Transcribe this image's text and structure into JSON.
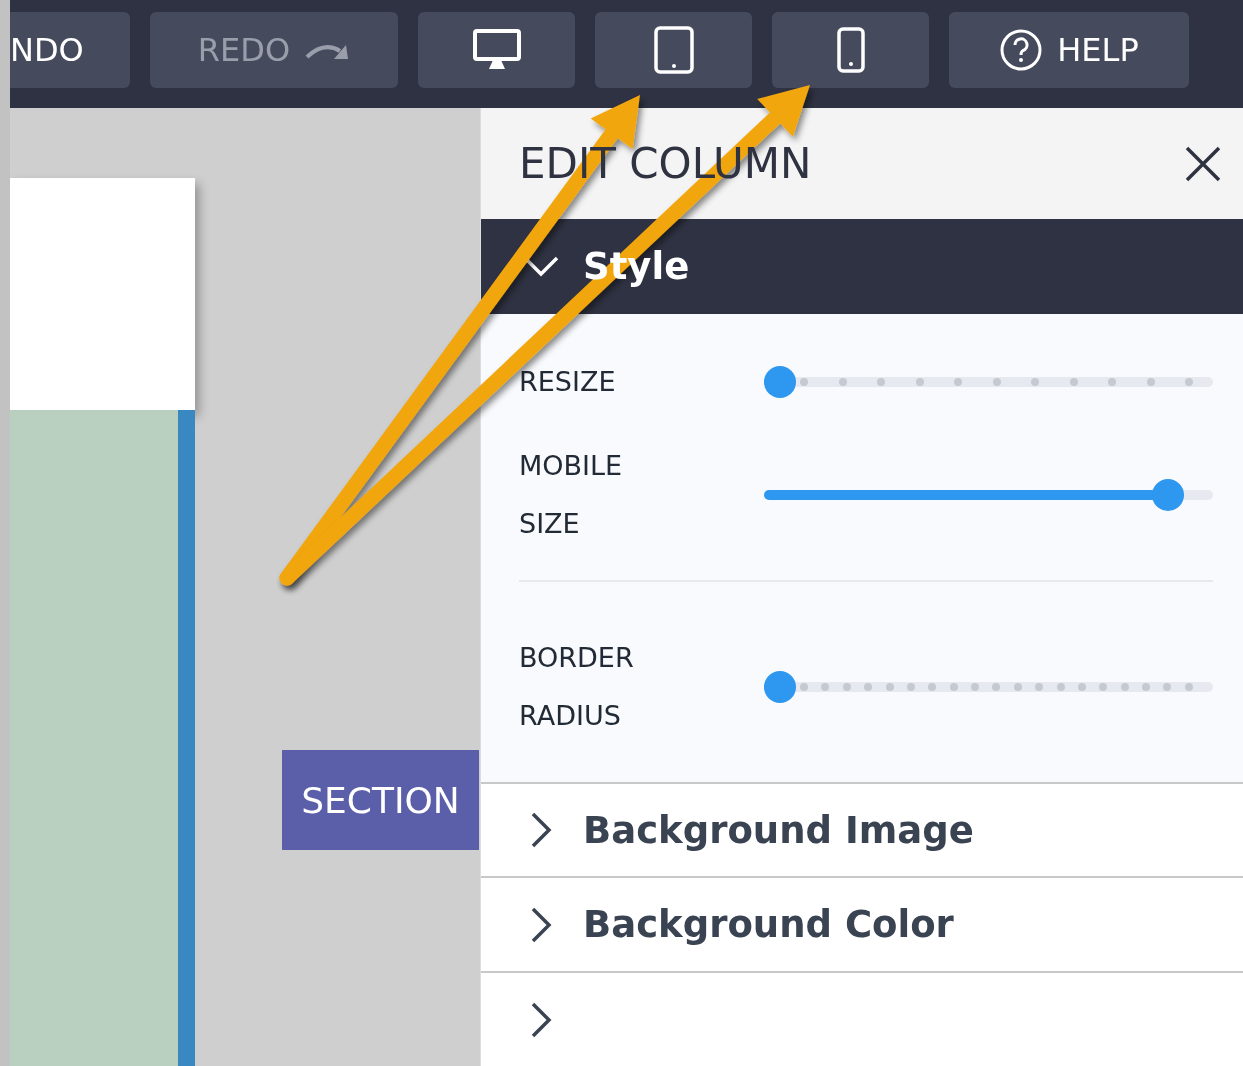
{
  "toolbar": [
    {
      "kind": "text",
      "label": "NDO",
      "disabled": false
    },
    {
      "kind": "redo",
      "label": "REDO",
      "disabled": true
    },
    {
      "kind": "desktop"
    },
    {
      "kind": "tablet"
    },
    {
      "kind": "phone"
    },
    {
      "kind": "help",
      "label": "HELP",
      "disabled": false
    }
  ],
  "canvas": {
    "section_label": "SECTION"
  },
  "panel": {
    "title": "EDIT COLUMN",
    "sections": [
      {
        "title": "Style",
        "expanded": true,
        "settings": [
          {
            "label": "RESIZE",
            "kind": "stepped",
            "level": 0
          },
          {
            "label": "MOBILE SIZE",
            "kind": "smooth",
            "level": 0.93
          },
          {
            "label": "BORDER RADIUS",
            "kind": "stepped",
            "level": 0
          }
        ]
      },
      {
        "title": "Background Image",
        "expanded": false
      },
      {
        "title": "Background Color",
        "expanded": false
      },
      {
        "expanded": false
      }
    ]
  },
  "annotations": [
    {
      "kind": "arrow"
    },
    {
      "kind": "arrow"
    }
  ]
}
